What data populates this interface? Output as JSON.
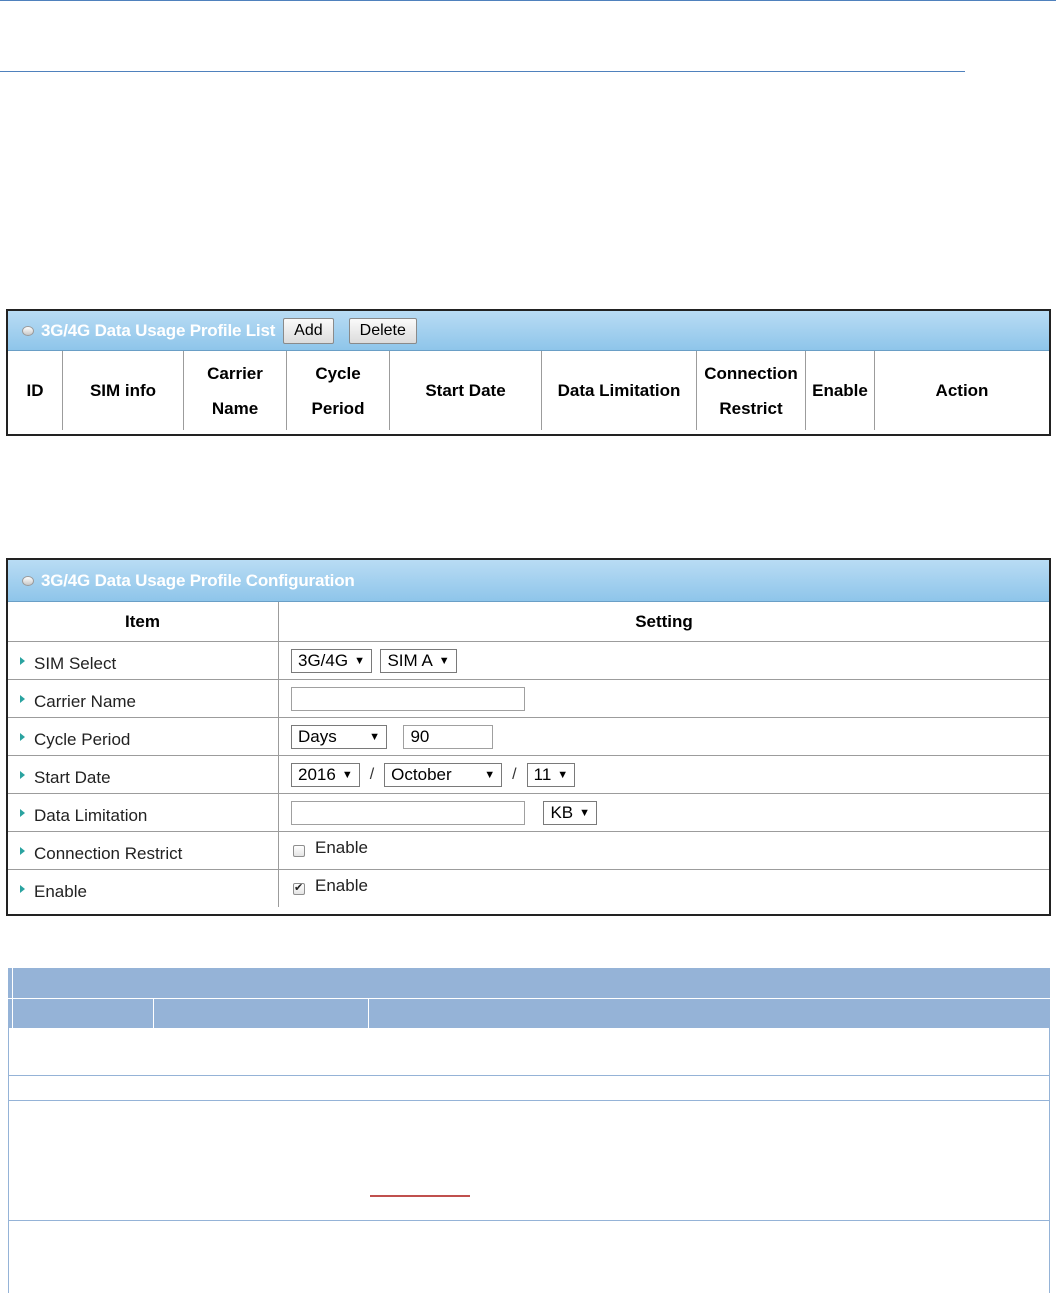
{
  "profile_list": {
    "title": "3G/4G Data Usage Profile List",
    "add_label": "Add",
    "delete_label": "Delete",
    "columns": [
      {
        "line1": "ID",
        "line2": ""
      },
      {
        "line1": "SIM info",
        "line2": ""
      },
      {
        "line1": "Carrier",
        "line2": "Name"
      },
      {
        "line1": "Cycle",
        "line2": "Period"
      },
      {
        "line1": "Start Date",
        "line2": ""
      },
      {
        "line1": "Data Limitation",
        "line2": ""
      },
      {
        "line1": "Connection",
        "line2": "Restrict"
      },
      {
        "line1": "Enable",
        "line2": ""
      },
      {
        "line1": "Action",
        "line2": ""
      }
    ]
  },
  "config": {
    "title": "3G/4G Data Usage Profile Configuration",
    "header_item": "Item",
    "header_setting": "Setting",
    "rows": {
      "sim_select": {
        "label": "SIM Select",
        "interface_value": "3G/4G",
        "sim_value": "SIM A"
      },
      "carrier_name": {
        "label": "Carrier Name",
        "value": ""
      },
      "cycle_period": {
        "label": "Cycle Period",
        "unit_value": "Days",
        "value": "90"
      },
      "start_date": {
        "label": "Start Date",
        "year": "2016",
        "month": "October",
        "day": "11",
        "separator": "/"
      },
      "data_limitation": {
        "label": "Data Limitation",
        "value": "",
        "unit_value": "KB"
      },
      "connection_restrict": {
        "label": "Connection Restrict",
        "checkbox_label": "Enable",
        "checked": false
      },
      "enable": {
        "label": "Enable",
        "checkbox_label": "Enable",
        "checked": true
      }
    }
  },
  "colors": {
    "panel_header": "#8ec5ea",
    "table_header_blue": "#95b3d7",
    "rule": "#4f81bd",
    "link_underline": "#c0504d"
  }
}
